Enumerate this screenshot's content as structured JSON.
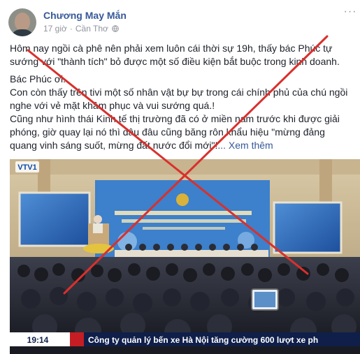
{
  "post": {
    "author": "Chương May Mắn",
    "time": "17 giờ",
    "separator": "·",
    "location": "Cần Thơ",
    "privacy_icon": "globe-icon",
    "more_icon": "more-options-icon",
    "paragraphs": [
      "Hôm nay ngồi cà phê nên phải xem luôn cái thời sự 19h, thấy bác Phúc tự sướng với \"thành tích\" bỏ được một số điều kiện bắt buộc trong kinh doanh.",
      "Bác Phúc ơi..",
      "Con còn thấy trên tivi một số nhân vật bự bự trong cái chính phủ của chú ngồi nghe với vẻ mặt khâm phục và vui sướng quá.!",
      "Cũng như hình thái Kinh tế thị trường đã có ở miền nam trước khi được giải phóng, giờ quay lại nó thì đâu đâu cũng băng rôn khẩu hiệu \"mừng đảng quang vinh sáng suốt, mừng đất nước đổi mới\"!"
    ],
    "see_more": "... Xem thêm",
    "accent_link": "#365899",
    "text_color": "#1d2129",
    "meta_color": "#90949c"
  },
  "photo": {
    "channel_logo": "VTV1",
    "ticker_time": "19:14",
    "ticker_text": "Công ty quản lý bến xe Hà Nội tăng cường 600 lượt xe ph",
    "cross_mark_color": "#d9302c"
  }
}
